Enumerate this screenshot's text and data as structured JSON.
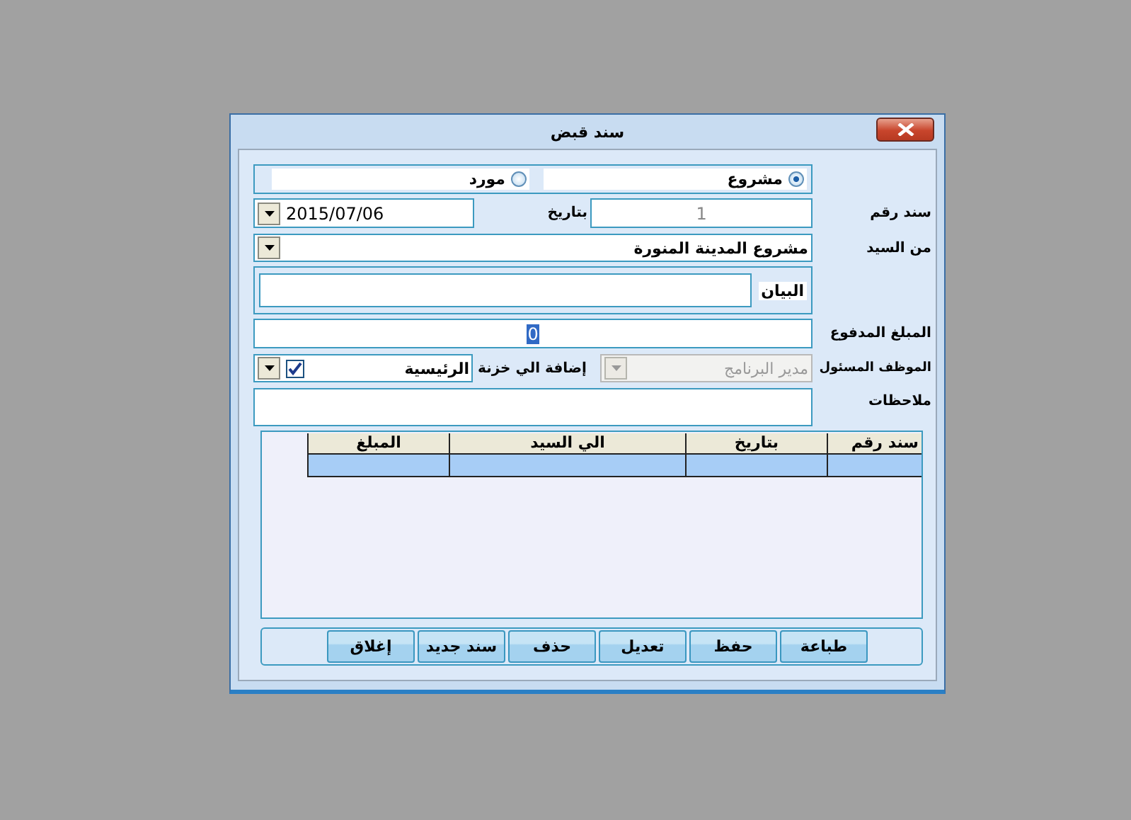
{
  "window": {
    "title": "سند قبض"
  },
  "party_type": [
    {
      "label": "مشروع",
      "selected": true
    },
    {
      "label": "مورد",
      "selected": false
    }
  ],
  "voucher_number": {
    "label": "سند رقم",
    "value": "1",
    "disabled": true
  },
  "date": {
    "label": "بتاريخ",
    "value": "2015/07/06"
  },
  "from": {
    "label": "من السيد",
    "value": "مشروع المدينة المنورة"
  },
  "description": {
    "label": "البيان"
  },
  "amount": {
    "label": "المبلغ المدفوع",
    "value": "0"
  },
  "employee": {
    "label": "الموظف المسئول",
    "value": "مدير البرنامج",
    "disabled": true
  },
  "treasury": {
    "label": "إضافة الي خزنة",
    "value": "الرئيسية",
    "checked": true
  },
  "notes": {
    "label": "ملاحظات"
  },
  "table": {
    "columns": [
      "سند رقم",
      "بتاريخ",
      "الي السيد",
      "المبلغ"
    ]
  },
  "buttons": [
    "طباعة",
    "حفظ",
    "تعديل",
    "حذف",
    "سند جديد",
    "إغلاق"
  ]
}
